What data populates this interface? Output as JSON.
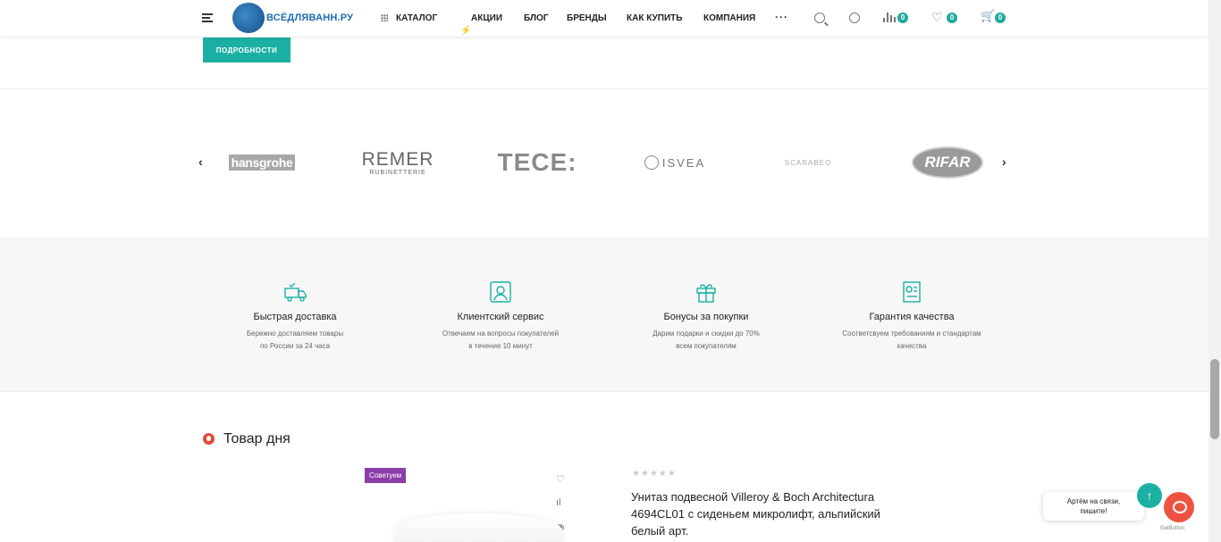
{
  "header": {
    "logo_text": "ВСЁДЛЯВАНН.РУ",
    "nav": [
      {
        "label": "Каталог"
      },
      {
        "label": "Акции"
      },
      {
        "label": "Блог"
      },
      {
        "label": "Бренды"
      },
      {
        "label": "Как купить"
      },
      {
        "label": "Компания"
      }
    ],
    "more": "···",
    "compare_count": "0",
    "favorites_count": "0",
    "cart_count": "0"
  },
  "details_button": "ПОДРОБНОСТИ",
  "brands": [
    {
      "name": "hansgrohe"
    },
    {
      "name": "REMER",
      "sub": "RUBINETTERIE"
    },
    {
      "name": "TECE:"
    },
    {
      "name": "ISVEA"
    },
    {
      "name": "SCARABEO"
    },
    {
      "name": "RIFAR"
    }
  ],
  "features": [
    {
      "icon": "delivery-truck-icon",
      "title": "Быстрая доставка",
      "desc_line1": "Бережно доставляем товары",
      "desc_line2": "по России за 24 часа"
    },
    {
      "icon": "customer-service-icon",
      "title": "Клиентский сервис",
      "desc_line1": "Отвечаем на вопросы покупателей",
      "desc_line2": "в течение 10 минут"
    },
    {
      "icon": "gift-icon",
      "title": "Бонусы за покупки",
      "desc_line1": "Дарим подарки и скидки до 70%",
      "desc_line2": "всем покупателям"
    },
    {
      "icon": "certificate-icon",
      "title": "Гарантия качества",
      "desc_line1": "Соответсвуем требованиям и стандартам",
      "desc_line2": "качества"
    }
  ],
  "product_of_day": {
    "title": "Товар дня",
    "tag": "Советуем",
    "stars": "★★★★★",
    "name": "Унитаз подвесной Villeroy & Boch Architectura 4694CL01 с сиденьем микролифт, альпийский белый арт."
  },
  "chat": {
    "line1": "Артём на связи,",
    "line2": "пишите!",
    "up": "↑",
    "powered": "GetButton"
  },
  "colors": {
    "accent": "#1bb0a3",
    "tag": "#8b3ea8",
    "hot": "#e44a3b"
  }
}
